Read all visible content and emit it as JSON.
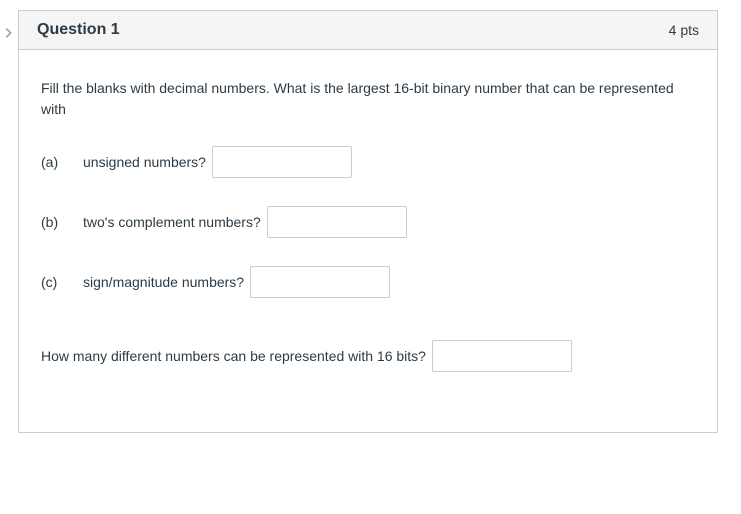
{
  "header": {
    "title": "Question 1",
    "points": "4 pts"
  },
  "body": {
    "prompt": "Fill the blanks with decimal numbers. What is the largest 16-bit binary number that can be represented with",
    "parts": [
      {
        "label": "(a)",
        "text": "unsigned numbers?",
        "value": ""
      },
      {
        "label": "(b)",
        "text": "two's complement numbers?",
        "value": ""
      },
      {
        "label": "(c)",
        "text": "sign/magnitude numbers?",
        "value": ""
      }
    ],
    "final_text": "How many different numbers can be represented with 16 bits?",
    "final_value": ""
  }
}
